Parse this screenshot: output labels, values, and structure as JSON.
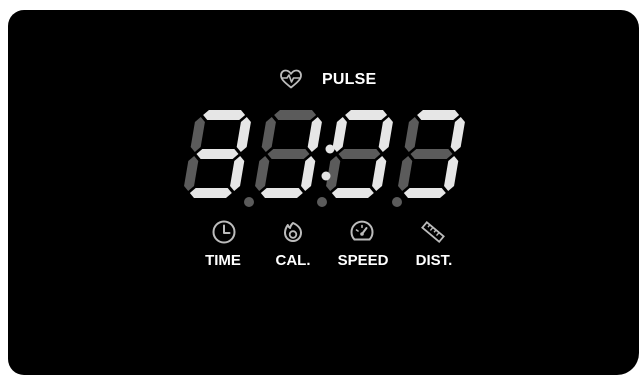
{
  "colors": {
    "segment_on": "#e6e6e6",
    "segment_off": "#5b5b5b",
    "label": "#ffffff",
    "icon": "#bcbcbc",
    "background": "#000000"
  },
  "pulse": {
    "label": "PULSE",
    "icon": "heart-pulse-icon"
  },
  "display": {
    "digits": [
      {
        "lit": [
          "a",
          "b",
          "c",
          "d",
          "g"
        ]
      },
      {
        "lit": [
          "b",
          "c",
          "d"
        ]
      },
      {
        "lit": [
          "a",
          "b",
          "c",
          "d",
          "f"
        ]
      },
      {
        "lit": [
          "a",
          "b",
          "c",
          "d"
        ]
      }
    ]
  },
  "modes": [
    {
      "label": "TIME",
      "icon": "clock-icon"
    },
    {
      "label": "CAL.",
      "icon": "flame-icon"
    },
    {
      "label": "SPEED",
      "icon": "speedometer-icon"
    },
    {
      "label": "DIST.",
      "icon": "ruler-icon"
    }
  ]
}
